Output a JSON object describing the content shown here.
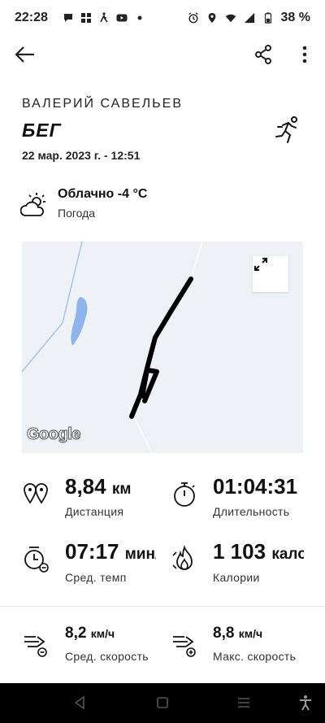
{
  "status_bar": {
    "time": "22:28",
    "battery": "38 %"
  },
  "activity": {
    "athlete_name": "ВАЛЕРИЙ САВЕЛЬЕВ",
    "sport": "БЕГ",
    "datetime": "22 мар. 2023 г. - 12:51"
  },
  "weather": {
    "condition": "Облачно -4 °C",
    "label": "Погода"
  },
  "map": {
    "attribution": "Google"
  },
  "stats": {
    "distance": {
      "value": "8,84",
      "unit": "км",
      "label": "Дистанция"
    },
    "duration": {
      "value": "01:04:31",
      "label": "Длительность"
    },
    "pace": {
      "value": "07:17",
      "unit": "мин/",
      "label": "Сред. темп"
    },
    "calories": {
      "value": "1 103",
      "unit": "калор",
      "label": "Калории"
    },
    "avg_speed": {
      "value": "8,2",
      "unit": "км/ч",
      "label": "Сред. скорость"
    },
    "max_speed": {
      "value": "8,8",
      "unit": "км/ч",
      "label": "Макс. скорость"
    }
  }
}
